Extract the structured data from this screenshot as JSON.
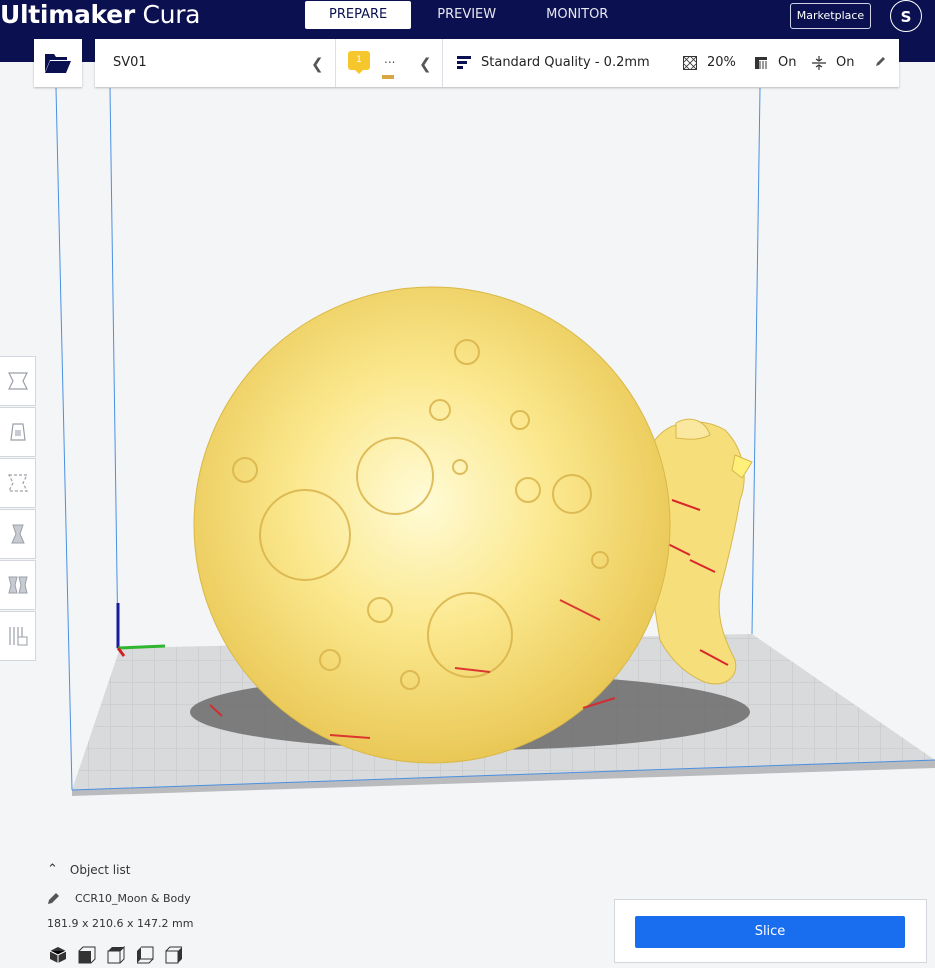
{
  "app": {
    "brand_bold": "Ultimaker",
    "brand_light": " Cura"
  },
  "stages": {
    "prepare": "PREPARE",
    "preview": "PREVIEW",
    "monitor": "MONITOR"
  },
  "header": {
    "marketplace": "Marketplace",
    "account_initial": "S"
  },
  "printer": {
    "name": "SV01"
  },
  "extruder": {
    "number": "1",
    "material": "..."
  },
  "print_settings": {
    "profile": "Standard Quality - 0.2mm",
    "infill": "20%",
    "support": "On",
    "adhesion": "On"
  },
  "object_list": {
    "label": "Object list",
    "object_name": "CCR10_Moon & Body",
    "dimensions": "181.9 x 210.6 x 147.2 mm"
  },
  "slice": {
    "label": "Slice"
  },
  "colors": {
    "header_bg": "#0b1150",
    "accent_blue": "#196ef0",
    "model_yellow": "#f8e27e",
    "overhang_red": "#d9262a",
    "extruder_yellow": "#f5c72d"
  },
  "icons": {
    "open": "folder-open-icon",
    "tools": [
      "move-icon",
      "scale-icon",
      "rotate-icon",
      "mirror-icon",
      "per-model-settings-icon",
      "support-blocker-icon"
    ],
    "infill": "infill-icon",
    "support": "support-icon",
    "adhesion": "adhesion-icon",
    "edit": "pencil-icon"
  }
}
